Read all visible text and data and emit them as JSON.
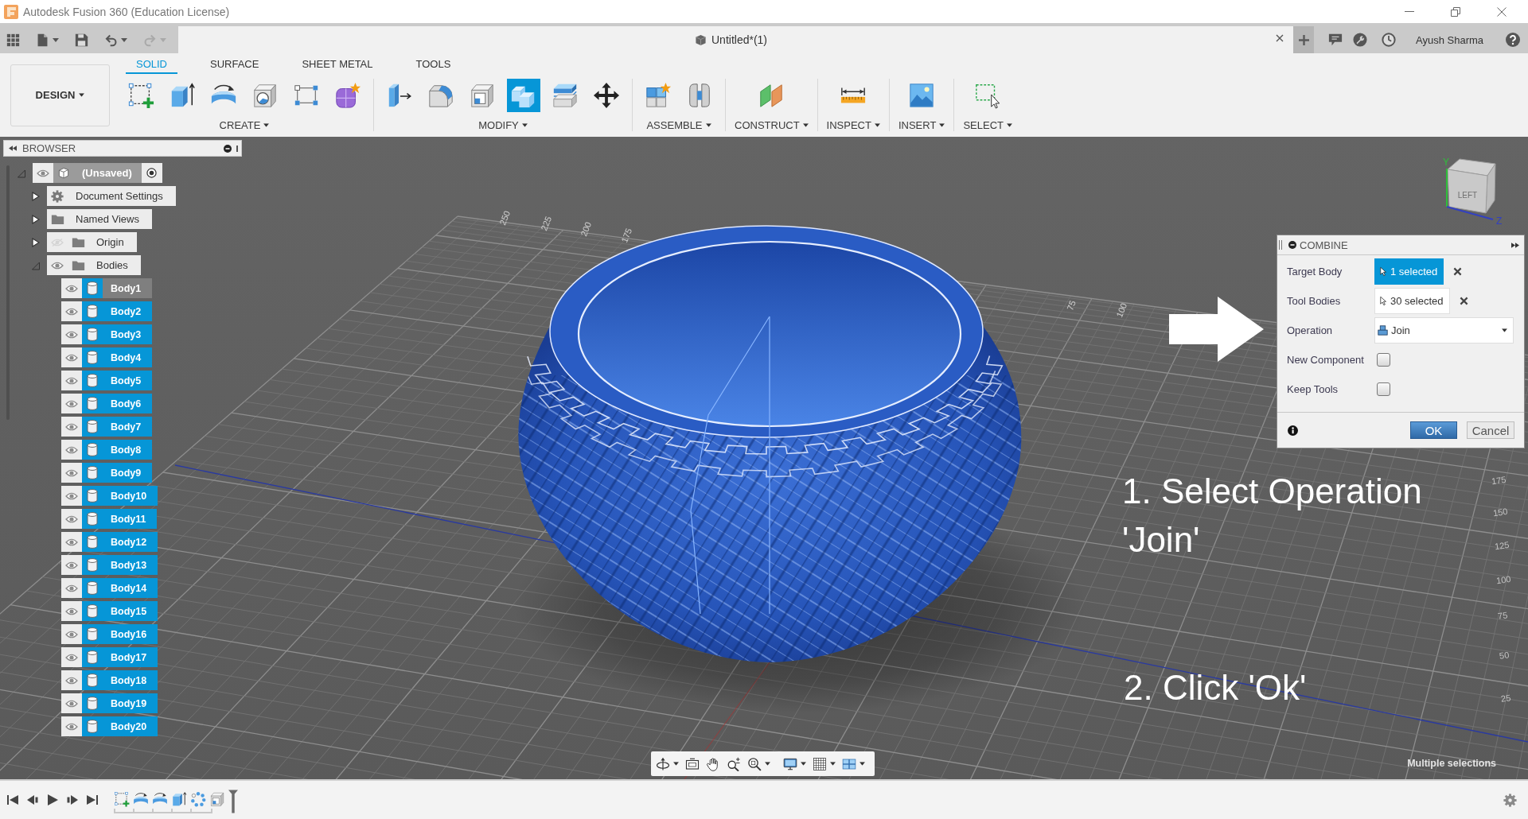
{
  "window": {
    "title": "Autodesk Fusion 360 (Education License)"
  },
  "quick_access": [
    {
      "kind": "apps",
      "disabled": false
    },
    {
      "kind": "file",
      "disabled": false
    },
    {
      "kind": "save",
      "disabled": false
    },
    {
      "kind": "undo",
      "disabled": false
    },
    {
      "kind": "redo",
      "disabled": true
    }
  ],
  "document_tab": {
    "title": "Untitled*(1)"
  },
  "account": {
    "user_name": "Ayush Sharma"
  },
  "workspace": {
    "label": "DESIGN"
  },
  "ribbon_tabs": [
    {
      "label": "SOLID",
      "selected": true
    },
    {
      "label": "SURFACE",
      "selected": false
    },
    {
      "label": "SHEET METAL",
      "selected": false
    },
    {
      "label": "TOOLS",
      "selected": false
    }
  ],
  "ribbon_groups": [
    {
      "label": "CREATE",
      "tools": [
        {
          "kind": "sketch",
          "selected": false
        },
        {
          "kind": "extrude",
          "selected": false
        },
        {
          "kind": "revolve",
          "selected": false
        },
        {
          "kind": "hole",
          "selected": false
        },
        {
          "kind": "pattern",
          "selected": false
        },
        {
          "kind": "form",
          "selected": false
        }
      ]
    },
    {
      "label": "MODIFY",
      "tools": [
        {
          "kind": "press-pull",
          "selected": false
        },
        {
          "kind": "fillet",
          "selected": false
        },
        {
          "kind": "shell",
          "selected": false
        },
        {
          "kind": "combine",
          "selected": true
        },
        {
          "kind": "offset-face",
          "selected": false
        },
        {
          "kind": "move",
          "selected": false
        }
      ]
    },
    {
      "label": "ASSEMBLE",
      "tools": [
        {
          "kind": "new-component",
          "selected": false
        },
        {
          "kind": "joint",
          "selected": false
        }
      ]
    },
    {
      "label": "CONSTRUCT",
      "tools": [
        {
          "kind": "offset-plane",
          "selected": false
        }
      ]
    },
    {
      "label": "INSPECT",
      "tools": [
        {
          "kind": "measure",
          "selected": false
        }
      ]
    },
    {
      "label": "INSERT",
      "tools": [
        {
          "kind": "insert-image",
          "selected": false
        }
      ]
    },
    {
      "label": "SELECT",
      "tools": [
        {
          "kind": "select-window",
          "selected": false
        }
      ]
    }
  ],
  "browser": {
    "title": "BROWSER",
    "tree": [
      {
        "label": "(Unsaved)",
        "kind": "component",
        "expanded": true,
        "visible": true,
        "active": true,
        "children": [
          {
            "label": "Document Settings",
            "kind": "settings",
            "expanded": false
          },
          {
            "label": "Named Views",
            "kind": "folder",
            "expanded": false
          },
          {
            "label": "Origin",
            "kind": "folder",
            "expanded": false,
            "visible": false
          },
          {
            "label": "Bodies",
            "kind": "folder",
            "expanded": true,
            "visible": true,
            "children": [
              {
                "label": "Body1",
                "kind": "body",
                "visible": true,
                "selected": true,
                "hovered": true
              },
              {
                "label": "Body2",
                "kind": "body",
                "visible": true,
                "selected": true,
                "hovered": false
              },
              {
                "label": "Body3",
                "kind": "body",
                "visible": true,
                "selected": true,
                "hovered": false
              },
              {
                "label": "Body4",
                "kind": "body",
                "visible": true,
                "selected": true,
                "hovered": false
              },
              {
                "label": "Body5",
                "kind": "body",
                "visible": true,
                "selected": true,
                "hovered": false
              },
              {
                "label": "Body6",
                "kind": "body",
                "visible": true,
                "selected": true,
                "hovered": false
              },
              {
                "label": "Body7",
                "kind": "body",
                "visible": true,
                "selected": true,
                "hovered": false
              },
              {
                "label": "Body8",
                "kind": "body",
                "visible": true,
                "selected": true,
                "hovered": false
              },
              {
                "label": "Body9",
                "kind": "body",
                "visible": true,
                "selected": true,
                "hovered": false
              },
              {
                "label": "Body10",
                "kind": "body",
                "visible": true,
                "selected": true,
                "hovered": false
              },
              {
                "label": "Body11",
                "kind": "body",
                "visible": true,
                "selected": true,
                "hovered": false
              },
              {
                "label": "Body12",
                "kind": "body",
                "visible": true,
                "selected": true,
                "hovered": false
              },
              {
                "label": "Body13",
                "kind": "body",
                "visible": true,
                "selected": true,
                "hovered": false
              },
              {
                "label": "Body14",
                "kind": "body",
                "visible": true,
                "selected": true,
                "hovered": false
              },
              {
                "label": "Body15",
                "kind": "body",
                "visible": true,
                "selected": true,
                "hovered": false
              },
              {
                "label": "Body16",
                "kind": "body",
                "visible": true,
                "selected": true,
                "hovered": false
              },
              {
                "label": "Body17",
                "kind": "body",
                "visible": true,
                "selected": true,
                "hovered": false
              },
              {
                "label": "Body18",
                "kind": "body",
                "visible": true,
                "selected": true,
                "hovered": false
              },
              {
                "label": "Body19",
                "kind": "body",
                "visible": true,
                "selected": true,
                "hovered": false
              },
              {
                "label": "Body20",
                "kind": "body",
                "visible": true,
                "selected": true,
                "hovered": false
              }
            ]
          }
        ]
      }
    ]
  },
  "combine": {
    "title": "COMBINE",
    "rows": [
      {
        "kind": "selection",
        "label": "Target Body",
        "value": "1 selected",
        "active": true
      },
      {
        "kind": "selection",
        "label": "Tool Bodies",
        "value": "30 selected",
        "active": false
      },
      {
        "kind": "dropdown",
        "label": "Operation",
        "value": "Join"
      },
      {
        "kind": "checkbox",
        "label": "New Component",
        "checked": false
      },
      {
        "kind": "checkbox",
        "label": "Keep Tools",
        "checked": false
      }
    ],
    "buttons": [
      {
        "label": "OK",
        "kind": "primary"
      },
      {
        "label": "Cancel",
        "kind": "secondary"
      }
    ]
  },
  "annotations": [
    {
      "text": "1. Select Operation 'Join'"
    },
    {
      "text": "2. Click 'Ok'"
    }
  ],
  "grid_labels": {
    "back_edge": [
      "250",
      "225",
      "200",
      "175",
      "75",
      "100"
    ],
    "right_edge": [
      "175",
      "150",
      "125",
      "100",
      "75",
      "50",
      "25"
    ]
  },
  "view_cube": {
    "face_label": "LEFT",
    "axis_labels": [
      "Y",
      "Z"
    ]
  },
  "status": {
    "text": "Multiple selections"
  }
}
